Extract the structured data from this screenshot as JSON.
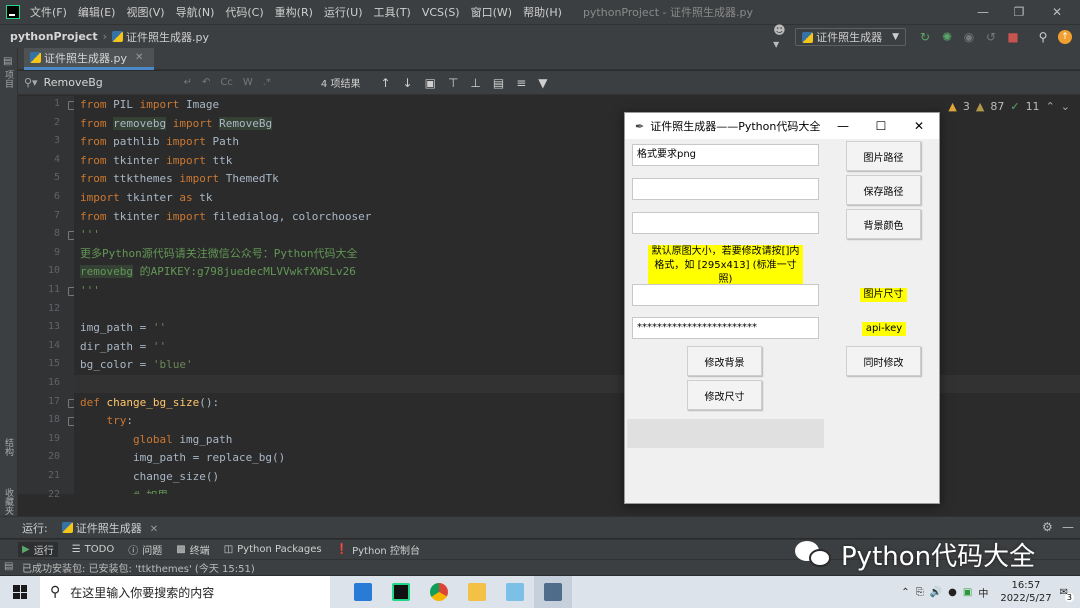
{
  "menubar": {
    "items": [
      "文件(F)",
      "编辑(E)",
      "视图(V)",
      "导航(N)",
      "代码(C)",
      "重构(R)",
      "运行(U)",
      "工具(T)",
      "VCS(S)",
      "窗口(W)",
      "帮助(H)"
    ],
    "window_title": "pythonProject - 证件照生成器.py"
  },
  "navbar": {
    "project": "pythonProject",
    "file": "证件照生成器.py",
    "run_config": "证件照生成器"
  },
  "left_tool_labels": [
    "项目",
    "结构",
    "收藏夹"
  ],
  "tab": {
    "label": "证件照生成器.py"
  },
  "search": {
    "value": "RemoveBg",
    "options": [
      "Cc",
      "W",
      ".*"
    ],
    "result_count": "4 项结果"
  },
  "inspections": {
    "warnings": "3",
    "weak_warnings": "87",
    "ok": "11"
  },
  "code": {
    "line_numbers": [
      "1",
      "2",
      "3",
      "4",
      "5",
      "6",
      "7",
      "8",
      "9",
      "10",
      "11",
      "12",
      "13",
      "14",
      "15",
      "16",
      "17",
      "18",
      "19",
      "20",
      "21",
      "22"
    ],
    "lines": [
      [
        {
          "t": "from ",
          "c": "kw"
        },
        {
          "t": "PIL ",
          "c": ""
        },
        {
          "t": "import ",
          "c": "kw"
        },
        {
          "t": "Image",
          "c": ""
        }
      ],
      [
        {
          "t": "from ",
          "c": "kw"
        },
        {
          "t": "removebg",
          "c": "hl"
        },
        {
          "t": " ",
          "c": ""
        },
        {
          "t": "import ",
          "c": "kw"
        },
        {
          "t": "RemoveBg",
          "c": "hl"
        }
      ],
      [
        {
          "t": "from ",
          "c": "kw"
        },
        {
          "t": "pathlib ",
          "c": ""
        },
        {
          "t": "import ",
          "c": "kw"
        },
        {
          "t": "Path",
          "c": ""
        }
      ],
      [
        {
          "t": "from ",
          "c": "kw"
        },
        {
          "t": "tkinter ",
          "c": ""
        },
        {
          "t": "import ",
          "c": "kw"
        },
        {
          "t": "ttk",
          "c": ""
        }
      ],
      [
        {
          "t": "from ",
          "c": "kw"
        },
        {
          "t": "ttkthemes ",
          "c": ""
        },
        {
          "t": "import ",
          "c": "kw"
        },
        {
          "t": "ThemedTk",
          "c": ""
        }
      ],
      [
        {
          "t": "import ",
          "c": "kw"
        },
        {
          "t": "tkinter ",
          "c": ""
        },
        {
          "t": "as ",
          "c": "kw"
        },
        {
          "t": "tk",
          "c": ""
        }
      ],
      [
        {
          "t": "from ",
          "c": "kw"
        },
        {
          "t": "tkinter ",
          "c": ""
        },
        {
          "t": "import ",
          "c": "kw"
        },
        {
          "t": "filedialog, colorchooser",
          "c": ""
        }
      ],
      [
        {
          "t": "'''",
          "c": "cmt"
        }
      ],
      [
        {
          "t": "更多Python源代码请关注微信公众号：Python代码大全",
          "c": "cmt"
        }
      ],
      [
        {
          "t": "removebg",
          "c": "cmt hl"
        },
        {
          "t": " 的APIKEY:g798juedecMLVVwkfXWSLv26",
          "c": "cmt"
        }
      ],
      [
        {
          "t": "'''",
          "c": "cmt"
        }
      ],
      [],
      [
        {
          "t": "img_path = ",
          "c": ""
        },
        {
          "t": "''",
          "c": "str"
        }
      ],
      [
        {
          "t": "dir_path = ",
          "c": ""
        },
        {
          "t": "''",
          "c": "str"
        }
      ],
      [
        {
          "t": "bg_color = ",
          "c": ""
        },
        {
          "t": "'blue'",
          "c": "str"
        }
      ],
      [],
      [
        {
          "t": "def ",
          "c": "kw"
        },
        {
          "t": "change_bg_size",
          "c": "fn"
        },
        {
          "t": "():",
          "c": ""
        }
      ],
      [
        {
          "t": "    try",
          "c": "kw"
        },
        {
          "t": ":",
          "c": ""
        }
      ],
      [
        {
          "t": "        global ",
          "c": "kw"
        },
        {
          "t": "img_path",
          "c": ""
        }
      ],
      [
        {
          "t": "        img_path = replace_bg()",
          "c": ""
        }
      ],
      [
        {
          "t": "        change_size()",
          "c": ""
        }
      ],
      [
        {
          "t": "        # 如果...",
          "c": "cmt"
        }
      ]
    ]
  },
  "bottom": {
    "run_label": "运行:",
    "run_tab": "证件照生成器",
    "tool_windows": [
      "运行",
      "TODO",
      "问题",
      "终端",
      "Python Packages",
      "Python 控制台"
    ],
    "status_message": "已成功安装包: 已安装包: 'ttkthemes' (今天 15:51)"
  },
  "watermark": "Python代码大全",
  "tk_window": {
    "title": "证件照生成器——Python代码大全",
    "entry_format": "格式要求png",
    "entry_path_blank_1": "",
    "entry_path_blank_2": "",
    "hint_line1": "默认原图大小，若要修改请按[]内",
    "hint_line2": "格式，如 [295x413] (标准一寸照)",
    "entry_size": "",
    "entry_apikey": "************************",
    "btn_image_path": "图片路径",
    "btn_save_path": "保存路径",
    "btn_bg_color": "背景颜色",
    "label_size": "图片尺寸",
    "label_apikey": "api-key",
    "btn_change_bg": "修改背景",
    "btn_both": "同时修改",
    "btn_change_size": "修改尺寸"
  },
  "taskbar": {
    "search_placeholder": "在这里输入你要搜索的内容",
    "time": "16:57",
    "date": "2022/5/27",
    "notifications": "3"
  },
  "colors": {
    "keyword": "#cc7832",
    "string": "#6a8759",
    "comment": "#629755",
    "function": "#ffc66d",
    "highlight_label": "#ffff00"
  }
}
